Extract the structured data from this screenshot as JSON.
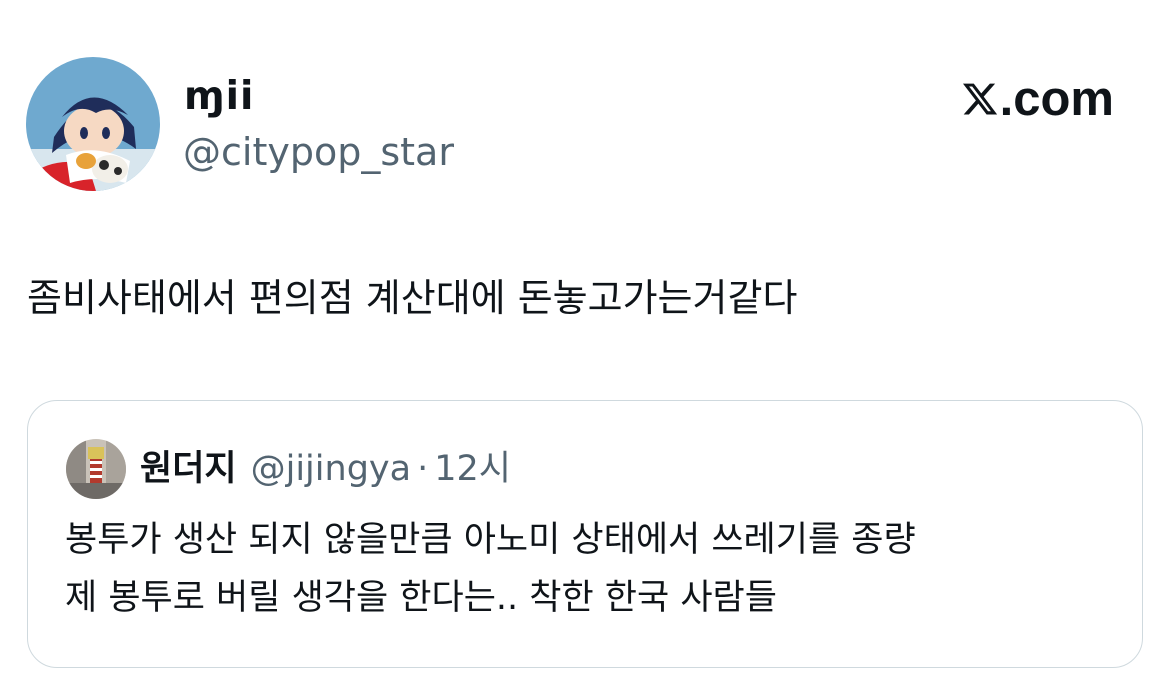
{
  "author": {
    "display_name": "ɱii",
    "handle": "@citypop_star"
  },
  "brand": {
    "label": ".com",
    "icon": "x-logo-icon"
  },
  "tweet": {
    "text": "좀비사태에서 편의점 계산대에 돈놓고가는거같다"
  },
  "quote": {
    "display_name": "원더지",
    "handle": "@jijingya",
    "separator": "·",
    "time": "12시",
    "text_lines": [
      "봉투가 생산 되지 않을만큼 아노미 상태에서 쓰레기를 종량",
      "제 봉투로 버릴 생각을 한다는.. 착한 한국 사람들"
    ]
  },
  "colors": {
    "text_primary": "#0f1419",
    "text_secondary": "#536471",
    "border": "#cfd9de"
  }
}
